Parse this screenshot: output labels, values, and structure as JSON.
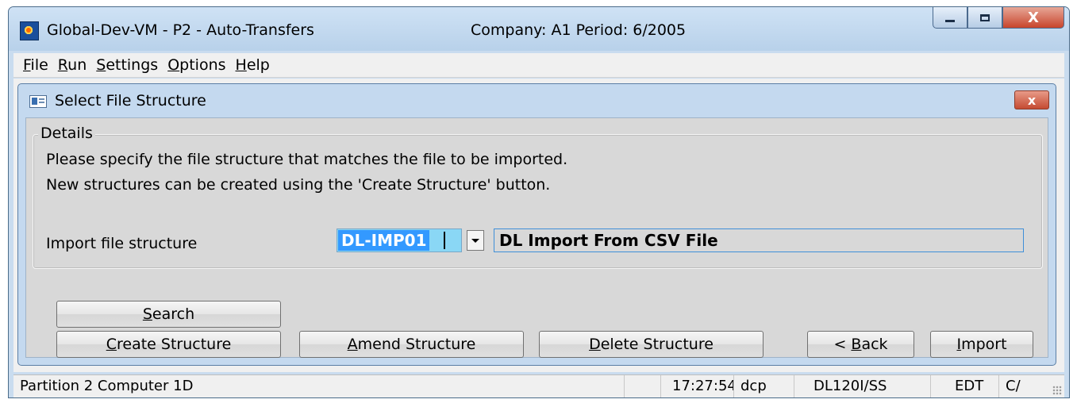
{
  "window": {
    "title": "Global-Dev-VM - P2 - Auto-Transfers",
    "company_period": "Company: A1  Period:  6/2005",
    "close_glyph": "X"
  },
  "menu": [
    {
      "label": "File",
      "accel": "F"
    },
    {
      "label": "Run",
      "accel": "R"
    },
    {
      "label": "Settings",
      "accel": "S"
    },
    {
      "label": "Options",
      "accel": "O"
    },
    {
      "label": "Help",
      "accel": "H"
    }
  ],
  "dialog": {
    "title": "Select File Structure",
    "close_glyph": "x",
    "group_label": "Details",
    "line1": "Please specify the file structure that matches the file to be imported.",
    "line2": "New structures can be created using the 'Create Structure' button.",
    "import_label": "Import file structure",
    "structure_code": "DL-IMP01",
    "structure_description": "DL Import From CSV File"
  },
  "buttons": {
    "search": {
      "accel": "S",
      "rest": "earch"
    },
    "create": {
      "accel": "C",
      "rest": "reate Structure"
    },
    "amend": {
      "accel": "A",
      "rest": "mend Structure"
    },
    "delete": {
      "accel": "D",
      "rest": "elete Structure"
    },
    "back": {
      "pre": "< ",
      "accel": "B",
      "rest": "ack"
    },
    "import": {
      "accel": "I",
      "rest": "mport"
    }
  },
  "status": {
    "partition": "Partition 2 Computer 1D",
    "time": "17:27:54",
    "user": "dcp",
    "program": "DL120I/SS",
    "mode": "EDT",
    "extra": "C/"
  },
  "icons": {
    "app": "app-logo-icon",
    "dialog": "form-icon",
    "dropdown": "chevron-down-icon"
  }
}
